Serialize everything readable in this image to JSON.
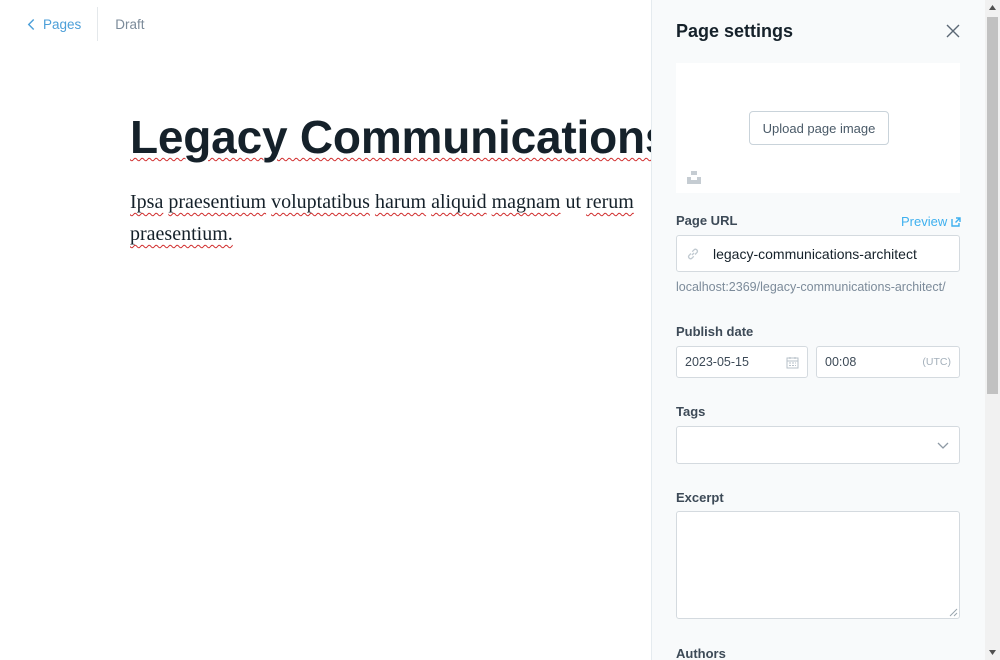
{
  "topbar": {
    "back_label": "Pages",
    "status": "Draft"
  },
  "editor": {
    "title": "Legacy Communications Architect",
    "body_words": [
      "Ipsa",
      "praesentium",
      "voluptatibus",
      "harum",
      "aliquid",
      "magnam",
      "ut",
      "rerum",
      "praesentium."
    ]
  },
  "settings": {
    "title": "Page settings",
    "upload_label": "Upload page image",
    "url_label": "Page URL",
    "preview_label": "Preview",
    "url_value": "legacy-communications-architect",
    "url_hint": "localhost:2369/legacy-communications-architect/",
    "publish_date_label": "Publish date",
    "date_value": "2023-05-15",
    "time_value": "00:08",
    "timezone": "(UTC)",
    "tags_label": "Tags",
    "excerpt_label": "Excerpt",
    "authors_label": "Authors"
  },
  "icons": {
    "back": "chevron-left-icon",
    "close": "close-icon",
    "unsplash": "unsplash-icon",
    "preview": "external-link-icon",
    "link": "link-icon",
    "calendar": "calendar-icon",
    "tags": "chevron-down-icon"
  },
  "colors": {
    "accent": "#3eb0ef",
    "text": "#15212a",
    "muted": "#7c8b9a",
    "panel_bg": "#f8fafb",
    "spellcheck": "#d02b2b"
  }
}
